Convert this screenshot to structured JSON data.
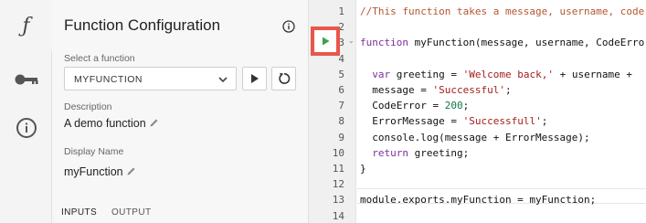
{
  "colors": {
    "highlight_border": "#e8574a",
    "run_icon": "#3aa34a",
    "comment": "#b5552f",
    "keyword": "#7a2f9c",
    "string": "#a2201d",
    "number": "#117744"
  },
  "rail": {
    "items": [
      {
        "icon": "function-icon",
        "glyph": "ƒ"
      },
      {
        "icon": "key-icon"
      },
      {
        "icon": "info-icon"
      }
    ]
  },
  "panel": {
    "title": "Function Configuration",
    "select_label": "Select a function",
    "select_value": "MYFUNCTION",
    "description_label": "Description",
    "description_value": "A demo function",
    "display_name_label": "Display Name",
    "display_name_value": "myFunction",
    "tabs": [
      "INPUTS",
      "OUTPUT"
    ]
  },
  "editor": {
    "line_numbers": [
      "1",
      "2",
      "3",
      "4",
      "5",
      "6",
      "7",
      "8",
      "9",
      "10",
      "11",
      "12",
      "13",
      "14"
    ],
    "lines": [
      [
        {
          "t": "//This function takes a message, username, code",
          "c": "com"
        }
      ],
      [],
      [
        {
          "t": "function ",
          "c": "kw"
        },
        {
          "t": "myFunction(message, username, CodeErro",
          "c": "fn"
        }
      ],
      [],
      [
        {
          "t": "  var ",
          "c": "kw"
        },
        {
          "t": "greeting = ",
          "c": "fn"
        },
        {
          "t": "'Welcome back,'",
          "c": "str"
        },
        {
          "t": " + username +",
          "c": "fn"
        }
      ],
      [
        {
          "t": "  message = ",
          "c": "fn"
        },
        {
          "t": "'Successful'",
          "c": "str"
        },
        {
          "t": ";",
          "c": "fn"
        }
      ],
      [
        {
          "t": "  CodeError = ",
          "c": "fn"
        },
        {
          "t": "200",
          "c": "num"
        },
        {
          "t": ";",
          "c": "fn"
        }
      ],
      [
        {
          "t": "  ErrorMessage = ",
          "c": "fn"
        },
        {
          "t": "'Successfull'",
          "c": "str"
        },
        {
          "t": ";",
          "c": "fn"
        }
      ],
      [
        {
          "t": "  console.log(message + ErrorMessage);",
          "c": "fn"
        }
      ],
      [
        {
          "t": "  return ",
          "c": "kw"
        },
        {
          "t": "greeting;",
          "c": "fn"
        }
      ],
      [
        {
          "t": "}",
          "c": "fn"
        }
      ],
      [],
      [
        {
          "t": "module.exports.myFunction = myFunction;",
          "c": "fn"
        }
      ],
      []
    ]
  }
}
